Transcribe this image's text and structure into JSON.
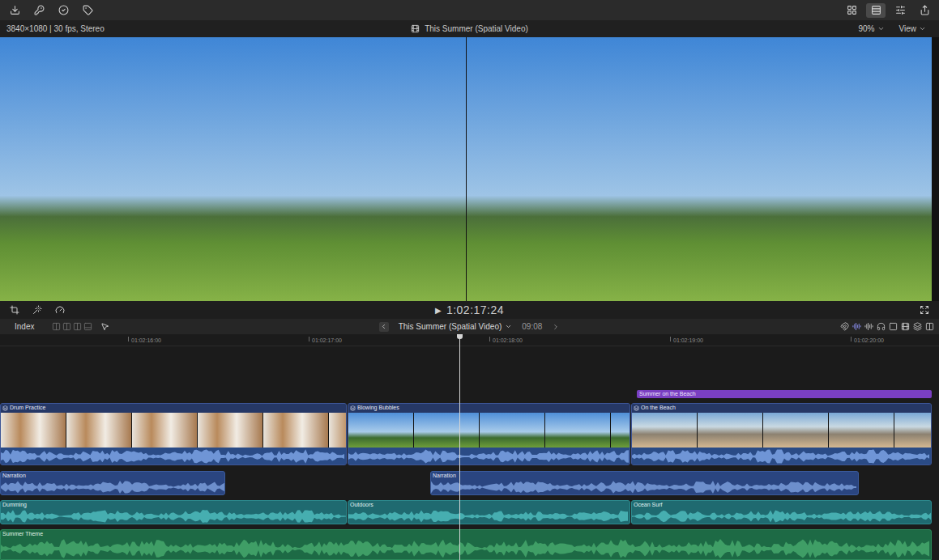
{
  "viewer": {
    "format": "3840×1080 | 30 fps, Stereo",
    "title": "This Summer (Spatial Video)",
    "zoom": "90%",
    "view": "View"
  },
  "transport": {
    "play": "▶",
    "timecode": "1:02:17:24"
  },
  "timeline": {
    "index": "Index",
    "project": "This Summer (Spatial Video)",
    "duration": "09:08"
  },
  "ruler": [
    "01:02:16:00",
    "01:02:17:00",
    "01:02:18:00",
    "01:02:19:00",
    "01:02:20:00"
  ],
  "title_clip": {
    "name": "Summer on the Beach"
  },
  "video_clips": [
    {
      "name": "Drum Practice"
    },
    {
      "name": "Blowing Bubbles"
    },
    {
      "name": "On the Beach"
    }
  ],
  "narration_clips": [
    {
      "name": "Narration"
    },
    {
      "name": "Narration"
    }
  ],
  "effect_clips": [
    {
      "name": "Dumming"
    },
    {
      "name": "Outdoors"
    },
    {
      "name": "Ocean Surf"
    }
  ],
  "music_clip": {
    "name": "Summer Theme"
  }
}
